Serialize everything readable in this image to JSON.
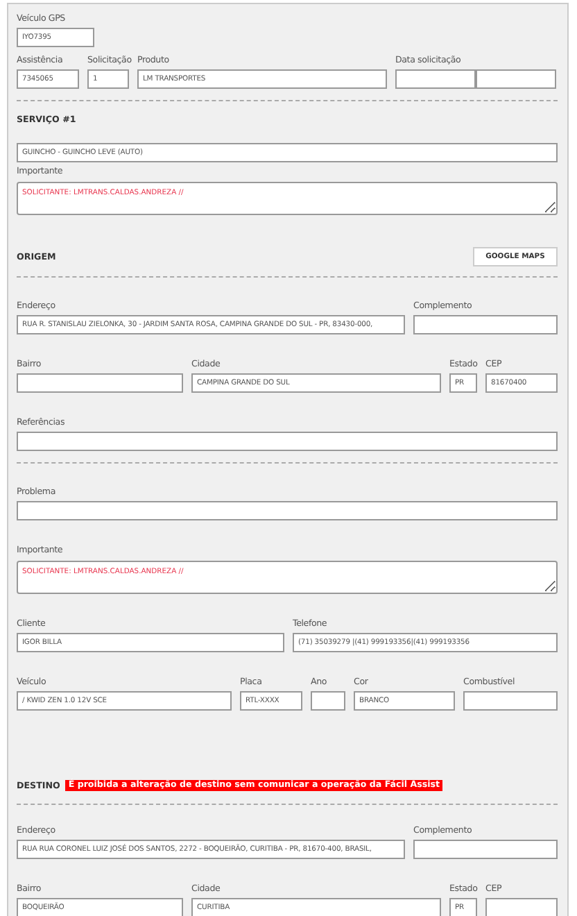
{
  "sections": [
    {
      "groups": [
        [
          [
            {
              "kind": "text",
              "label": "Veículo GPS",
              "value": "IYO7395"
            }
          ],
          [
            {
              "kind": "text",
              "label": "Assistência",
              "value": "7345065"
            },
            {
              "kind": "text",
              "label": "Solicitação",
              "value": "1"
            },
            {
              "kind": "text",
              "label": "Produto",
              "value": "LM TRANSPORTES"
            },
            {
              "kind": "split",
              "label": "Data solicitação"
            }
          ]
        ]
      ]
    },
    {
      "heading": "SERVIÇO #1",
      "groups": [
        [
          [
            {
              "kind": "text",
              "value": "GUINCHO - GUINCHO LEVE (AUTO)"
            }
          ],
          [
            {
              "kind": "textarea",
              "label": "Importante",
              "value": "SOLICITANTE: LMTRANS.CALDAS.ANDREZA //"
            }
          ]
        ]
      ]
    },
    {
      "heading": "ORIGEM",
      "button": "GOOGLE MAPS",
      "groups": [
        [
          [
            {
              "kind": "text",
              "label": "Endereço",
              "value": "RUA R. STANISLAU ZIELONKA, 30 - JARDIM SANTA ROSA, CAMPINA GRANDE DO SUL - PR, 83430-000,"
            },
            {
              "kind": "text",
              "label": "Complemento"
            }
          ],
          [
            {
              "kind": "text",
              "label": "Bairro"
            },
            {
              "kind": "text",
              "label": "Cidade",
              "value": "CAMPINA GRANDE DO SUL"
            },
            {
              "kind": "text",
              "label": "Estado",
              "value": "PR"
            },
            {
              "kind": "text",
              "label": "CEP",
              "value": "81670400"
            }
          ],
          [
            {
              "kind": "text",
              "label": "Referências"
            }
          ]
        ],
        [
          [
            {
              "kind": "text",
              "label": "Problema"
            }
          ],
          [
            {
              "kind": "textarea",
              "label": "Importante",
              "value": "SOLICITANTE: LMTRANS.CALDAS.ANDREZA //"
            }
          ],
          [
            {
              "kind": "text",
              "label": "Cliente",
              "value": "IGOR BILLA"
            },
            {
              "kind": "text",
              "label": "Telefone",
              "value": "(71) 35039279 |(41) 999193356|(41) 999193356"
            }
          ],
          [
            {
              "kind": "text",
              "label": "Veículo",
              "value": " / KWID ZEN 1.0 12V SCE"
            },
            {
              "kind": "text",
              "label": "Placa",
              "value": "RTL-XXXX"
            },
            {
              "kind": "text",
              "label": "Ano"
            },
            {
              "kind": "text",
              "label": "Cor",
              "value": "BRANCO"
            },
            {
              "kind": "text",
              "label": "Combustível"
            }
          ]
        ]
      ]
    },
    {
      "heading": "DESTINO",
      "warning": "É proibida a alteração de destino sem comunicar a operação da Fácil Assist",
      "groups": [
        [
          [
            {
              "kind": "text",
              "label": "Endereço",
              "value": "RUA RUA CORONEL LUIZ JOSÉ DOS SANTOS, 2272 - BOQUEIRÃO, CURITIBA - PR, 81670-400, BRASIL,"
            },
            {
              "kind": "text",
              "label": "Complemento"
            }
          ],
          [
            {
              "kind": "text",
              "label": "Bairro",
              "value": "BOQUEIRÃO"
            },
            {
              "kind": "text",
              "label": "Cidade",
              "value": "CURITIBA"
            },
            {
              "kind": "text",
              "label": "Estado",
              "value": "PR"
            },
            {
              "kind": "text",
              "label": "CEP"
            }
          ]
        ]
      ]
    }
  ]
}
